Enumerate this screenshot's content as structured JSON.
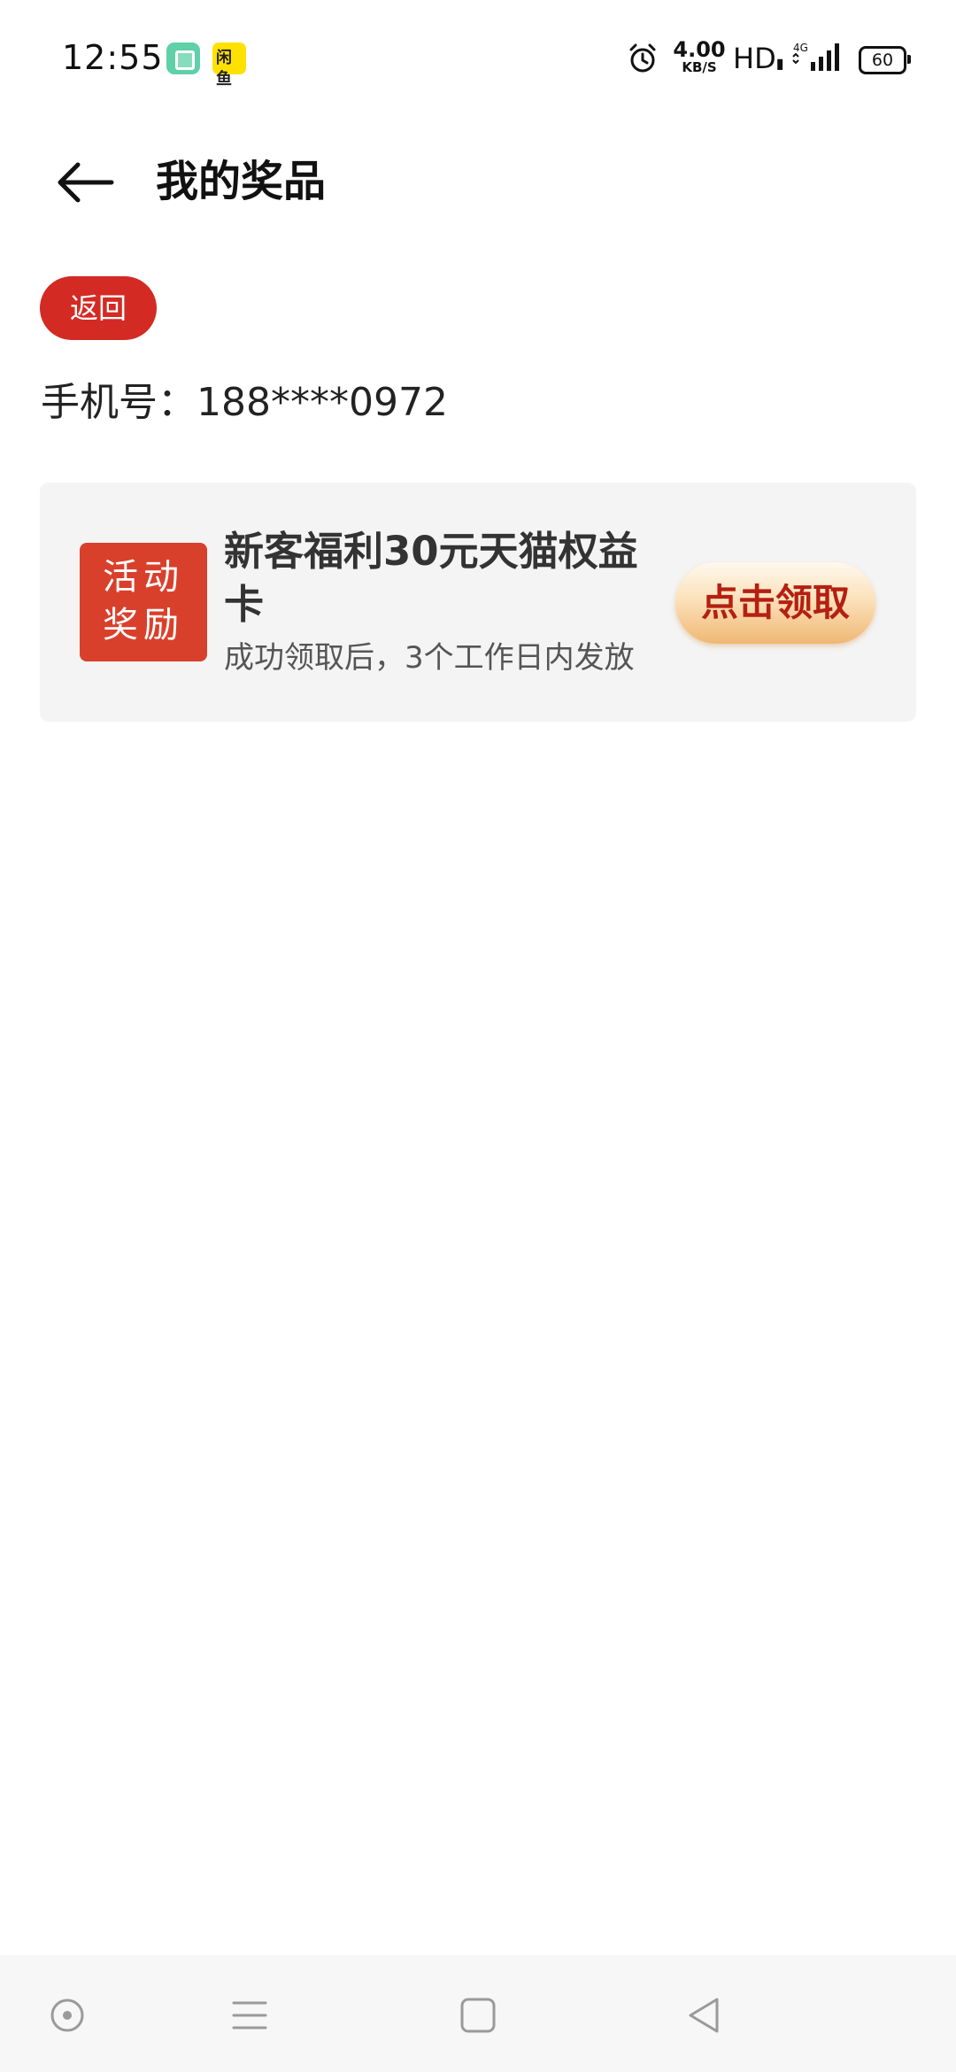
{
  "status_bar": {
    "time": "12:55",
    "notification_icons": [
      "green-app-icon",
      "yellow-app-icon"
    ],
    "yellow_icon_text": "闲鱼",
    "alarm_icon": "alarm-icon",
    "net_speed_value": "4.00",
    "net_speed_unit": "KB/S",
    "hd_label": "HD",
    "network_type": "4G",
    "battery_level": "60"
  },
  "header": {
    "back_icon": "arrow-left-icon",
    "title": "我的奖品"
  },
  "return_button_label": "返回",
  "phone": {
    "label": "手机号：",
    "value": "188****0972"
  },
  "prize": {
    "badge_line1": "活动",
    "badge_line2": "奖励",
    "title": "新客福利30元天猫权益卡",
    "subtitle": "成功领取后，3个工作日内发放",
    "claim_label": "点击领取"
  },
  "nav_bar": {
    "buttons": [
      "assistant-circle-icon",
      "menu-lines-icon",
      "home-square-icon",
      "back-triangle-icon"
    ]
  },
  "colors": {
    "accent_red": "#d42a24",
    "badge_red": "#d9402b",
    "claim_text": "#b51f12",
    "card_bg": "#f4f4f4"
  }
}
